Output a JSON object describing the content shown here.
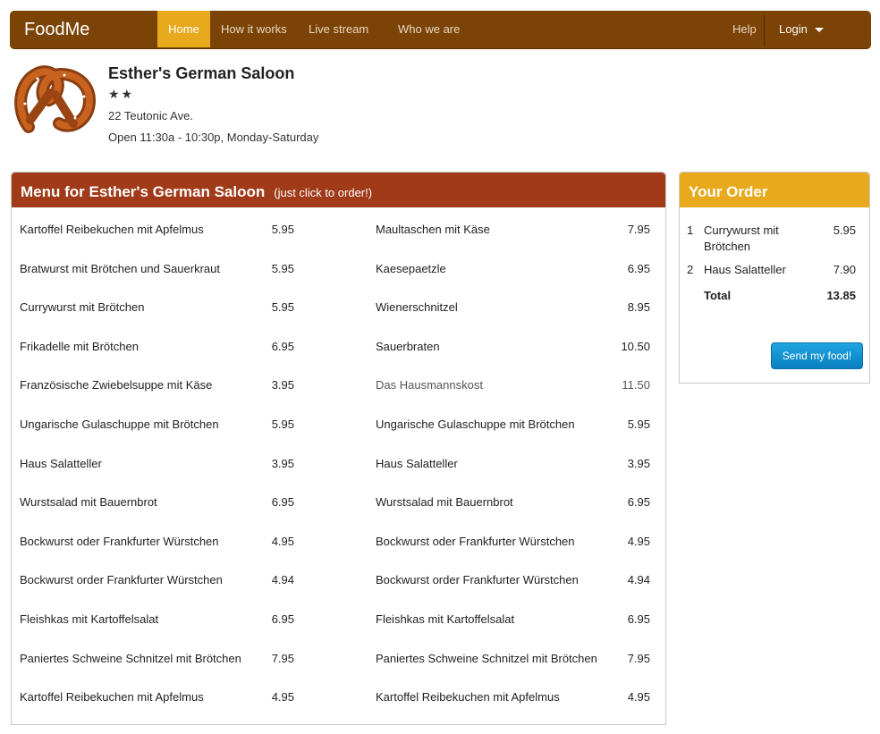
{
  "nav": {
    "brand": "FoodMe",
    "items": [
      "Home",
      "How it works",
      "Live stream",
      "Who we are"
    ],
    "active": "Home",
    "help": "Help",
    "login": "Login"
  },
  "restaurant": {
    "name": "Esther's German Saloon",
    "stars": "★★",
    "address": "22 Teutonic Ave.",
    "hours": "Open 11:30a - 10:30p, Monday-Saturday"
  },
  "menu": {
    "title": "Menu for Esther's German Saloon",
    "subtitle": "(just click to order!)",
    "left": [
      {
        "name": "Kartoffel Reibekuchen mit Apfelmus",
        "price": "5.95"
      },
      {
        "name": "Bratwurst mit Brötchen und Sauerkraut",
        "price": "5.95"
      },
      {
        "name": "Currywurst mit Brötchen",
        "price": "5.95"
      },
      {
        "name": "Frikadelle mit Brötchen",
        "price": "6.95"
      },
      {
        "name": "Französische Zwiebelsuppe mit Käse",
        "price": "3.95"
      },
      {
        "name": "Ungarische Gulaschuppe mit Brötchen",
        "price": "5.95"
      },
      {
        "name": "Haus Salatteller",
        "price": "3.95"
      },
      {
        "name": "Wurstsalad mit Bauernbrot",
        "price": "6.95"
      },
      {
        "name": "Bockwurst oder Frankfurter Würstchen",
        "price": "4.95"
      },
      {
        "name": "Bockwurst order Frankfurter Würstchen",
        "price": "4.94"
      },
      {
        "name": "Fleishkas mit Kartoffelsalat",
        "price": "6.95"
      },
      {
        "name": "Paniertes Schweine Schnitzel mit Brötchen",
        "price": "7.95"
      },
      {
        "name": "Kartoffel Reibekuchen mit Apfelmus",
        "price": "4.95"
      }
    ],
    "right": [
      {
        "name": "Maultaschen mit Käse",
        "price": "7.95"
      },
      {
        "name": "Kaesepaetzle",
        "price": "6.95"
      },
      {
        "name": "Wienerschnitzel",
        "price": "8.95"
      },
      {
        "name": "Sauerbraten",
        "price": "10.50"
      },
      {
        "name": "Das Hausmannskost",
        "price": "11.50"
      },
      {
        "name": "Ungarische Gulaschuppe mit Brötchen",
        "price": "5.95"
      },
      {
        "name": "Haus Salatteller",
        "price": "3.95"
      },
      {
        "name": "Wurstsalad mit Bauernbrot",
        "price": "6.95"
      },
      {
        "name": "Bockwurst oder Frankfurter Würstchen",
        "price": "4.95"
      },
      {
        "name": "Bockwurst order Frankfurter Würstchen",
        "price": "4.94"
      },
      {
        "name": "Fleishkas mit Kartoffelsalat",
        "price": "6.95"
      },
      {
        "name": "Paniertes Schweine Schnitzel mit Brötchen",
        "price": "7.95"
      },
      {
        "name": "Kartoffel Reibekuchen mit Apfelmus",
        "price": "4.95"
      }
    ]
  },
  "order": {
    "title": "Your Order",
    "items": [
      {
        "qty": "1",
        "name": "Currywurst mit Brötchen",
        "price": "5.95"
      },
      {
        "qty": "2",
        "name": "Haus Salatteller",
        "price": "7.90"
      }
    ],
    "total_label": "Total",
    "total": "13.85",
    "send_label": "Send my food!"
  },
  "colors": {
    "navbar": "#7b4306",
    "active_tab": "#e8a91c",
    "menu_header": "#a03a19",
    "order_header": "#e8a91c",
    "send_button": "#0a7fc0"
  }
}
